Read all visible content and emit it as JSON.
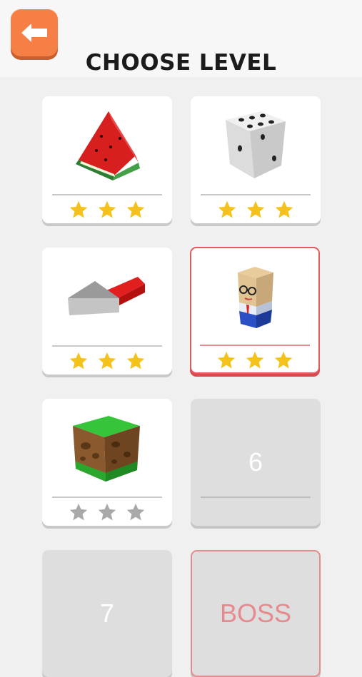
{
  "header": {
    "title": "CHOOSE LEVEL",
    "back_icon": "arrow-left-icon",
    "back_color": "#f57f45"
  },
  "levels": [
    {
      "name": "watermelon",
      "stars": 3,
      "earned": 3,
      "state": "unlocked"
    },
    {
      "name": "dice",
      "stars": 3,
      "earned": 3,
      "state": "unlocked"
    },
    {
      "name": "cheese-and-eraser",
      "stars": 3,
      "earned": 3,
      "state": "unlocked"
    },
    {
      "name": "office-man",
      "stars": 3,
      "earned": 3,
      "state": "selected"
    },
    {
      "name": "grass-block",
      "stars": 3,
      "earned": 0,
      "state": "unlocked"
    },
    {
      "label": "6",
      "state": "locked"
    },
    {
      "label": "7",
      "state": "locked"
    },
    {
      "label": "BOSS",
      "state": "boss"
    }
  ],
  "colors": {
    "star_gold": "#f5c21b",
    "star_gray": "#a9a9a9",
    "selected_border": "#e05a5e",
    "boss_text": "#e58a8d"
  }
}
